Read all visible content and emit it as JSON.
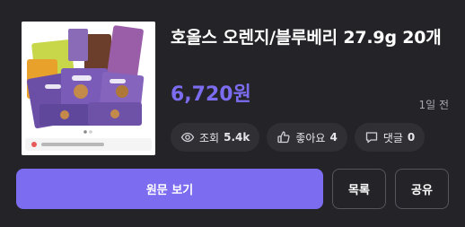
{
  "product": {
    "title": "호올스 오렌지/블루베리 27.9g 20개",
    "price": "6,720원",
    "posted": "1일 전",
    "image_icon": "product-photo-milka-snacks"
  },
  "stats": {
    "views_label": "조회",
    "views": "5.4k",
    "likes_label": "좋아요",
    "likes": "4",
    "comments_label": "댓글",
    "comments": "0"
  },
  "actions": {
    "view_original": "원문 보기",
    "list": "목록",
    "share": "공유"
  },
  "colors": {
    "background": "#242428",
    "accent": "#7b6cf0",
    "pill": "#2f2f34"
  }
}
